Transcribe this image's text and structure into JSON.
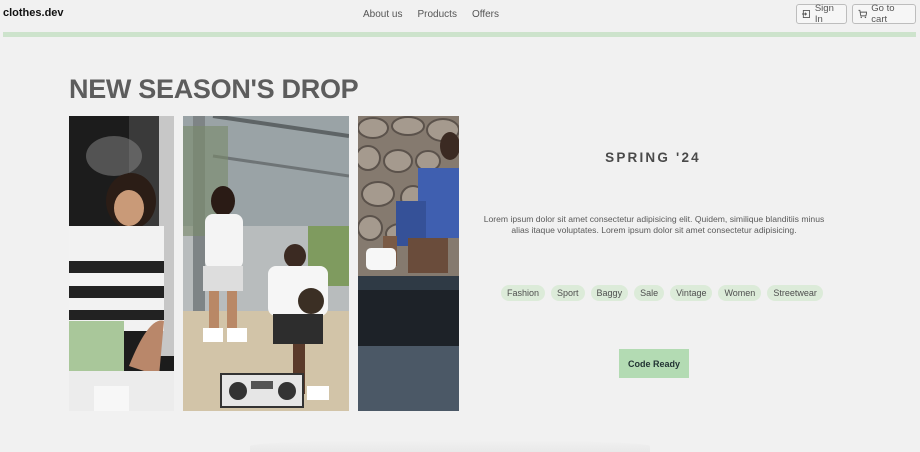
{
  "header": {
    "logo": "clothes.dev",
    "nav": [
      "About us",
      "Products",
      "Offers"
    ],
    "sign_in": "Sign In",
    "cart": "Go to cart"
  },
  "hero": {
    "headline": "NEW SEASON'S DROP",
    "season": "SPRING '24",
    "description": "Lorem ipsum dolor sit amet consectetur adipisicing elit. Quidem, similique blanditiis minus alias itaque voluptates. Lorem ipsum dolor sit amet consectetur adipisicing.",
    "tags": [
      "Fashion",
      "Sport",
      "Baggy",
      "Sale",
      "Vintage",
      "Women",
      "Streetwear"
    ],
    "cta": "Code Ready"
  },
  "photos": [
    "smoke-portrait-photo",
    "street-group-photo",
    "stone-wall-photo"
  ],
  "colors": {
    "accent_bar": "#cde3cc",
    "tag_bg": "#dcebd9",
    "cta_bg": "#b3dbb3",
    "background": "#f1f1f1"
  }
}
